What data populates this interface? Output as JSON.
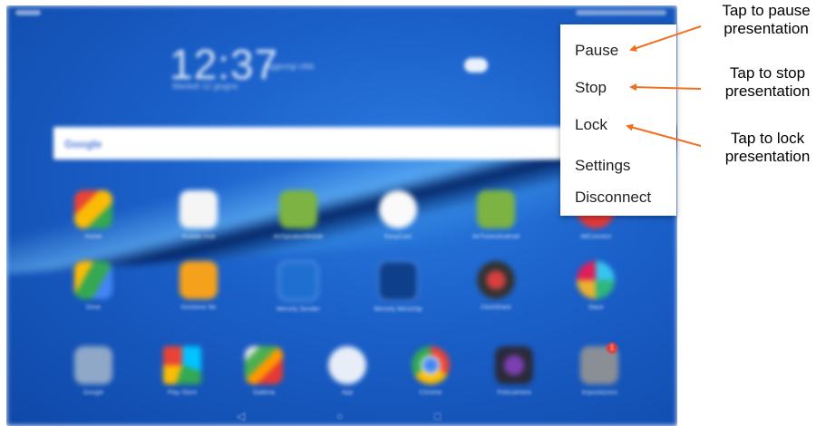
{
  "home_screen": {
    "clock_time": "12:37",
    "clock_date": "Martedì 12 giugno",
    "add_city": "Aggiungi città",
    "search_logo": "Google",
    "apps_row1": [
      "Home",
      "Huddle Hub",
      "AirSpeakerMobile",
      "EasyCast",
      "AirTunesAndroid",
      "AllConnect"
    ],
    "apps_row2": [
      "Drive",
      "Gestione file",
      "Mirrorly Sender",
      "Mirrorly MirrorOp",
      "ClickShare",
      "Slack"
    ],
    "apps_row3": [
      "Google",
      "Play Store",
      "Galleria",
      "App",
      "Chrome",
      "Fotocamera",
      "Impostazioni"
    ],
    "badge_count": "1"
  },
  "menu": {
    "items": [
      "Pause",
      "Stop",
      "Lock",
      "Settings",
      "Disconnect"
    ]
  },
  "annotations": {
    "pause": [
      "Tap to pause",
      "presentation"
    ],
    "stop": [
      "Tap to stop",
      "presentation"
    ],
    "lock": [
      "Tap to lock",
      "presentation"
    ]
  },
  "colors": {
    "arrow": "#f07020",
    "wallpaper": "#1a5fc8"
  }
}
